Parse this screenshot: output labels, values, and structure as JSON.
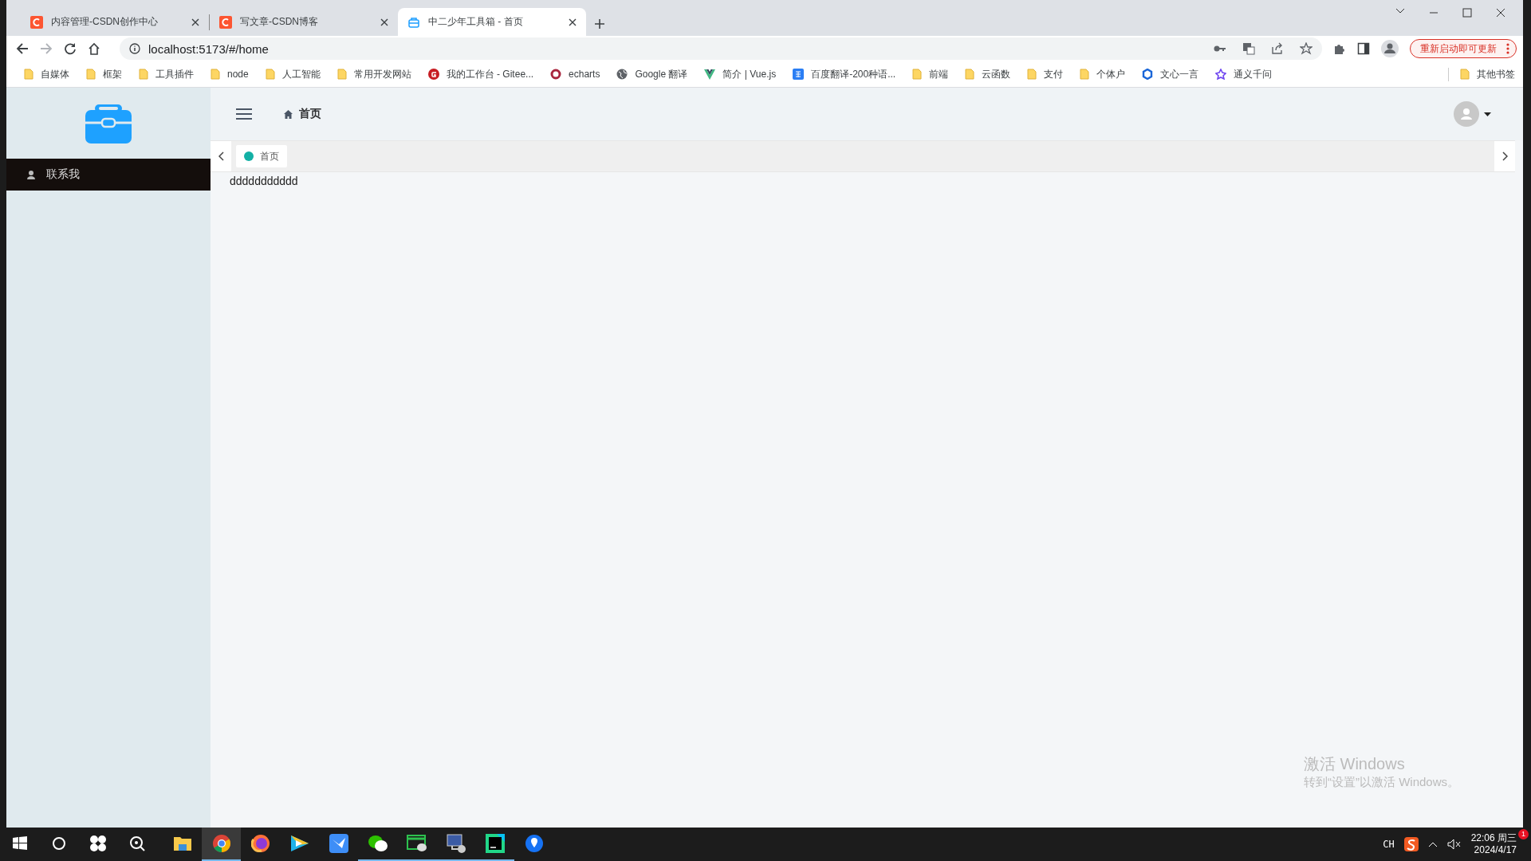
{
  "browser": {
    "tabs": [
      {
        "title": "内容管理-CSDN创作中心",
        "kind": "csdn",
        "selected": false
      },
      {
        "title": "写文章-CSDN博客",
        "kind": "csdn",
        "selected": false
      },
      {
        "title": "中二少年工具箱 - 首页",
        "kind": "toolbox",
        "selected": true
      }
    ],
    "nav": {
      "back_enabled": true,
      "forward_enabled": false
    },
    "address": "localhost:5173/#/home",
    "update_button": "重新启动即可更新",
    "bookmarks": [
      {
        "label": "自媒体",
        "kind": "folder"
      },
      {
        "label": "框架",
        "kind": "folder"
      },
      {
        "label": "工具插件",
        "kind": "folder"
      },
      {
        "label": "node",
        "kind": "folder"
      },
      {
        "label": "人工智能",
        "kind": "folder"
      },
      {
        "label": "常用开发网站",
        "kind": "folder"
      },
      {
        "label": "我的工作台 - Gitee...",
        "kind": "gitee"
      },
      {
        "label": "echarts",
        "kind": "ring"
      },
      {
        "label": "Google 翻译",
        "kind": "globe"
      },
      {
        "label": "简介 | Vue.js",
        "kind": "vue"
      },
      {
        "label": "百度翻译-200种语...",
        "kind": "square"
      },
      {
        "label": "前端",
        "kind": "folder"
      },
      {
        "label": "云函数",
        "kind": "folder"
      },
      {
        "label": "支付",
        "kind": "folder"
      },
      {
        "label": "个体户",
        "kind": "folder"
      },
      {
        "label": "文心一言",
        "kind": "hexagon"
      },
      {
        "label": "通义千问",
        "kind": "star"
      }
    ],
    "other_bookmarks": "其他书签"
  },
  "app": {
    "menu": [
      {
        "label": "联系我",
        "selected": true
      }
    ],
    "breadcrumb": "首页",
    "tags": [
      {
        "label": "首页",
        "selected": true
      }
    ],
    "content": "ddddddddddd"
  },
  "activation": {
    "title": "激活 Windows",
    "subtitle": "转到“设置”以激活 Windows。"
  },
  "taskbar": {
    "apps": [
      {
        "kind": "windows",
        "running": false,
        "selected": false
      },
      {
        "kind": "circle",
        "running": false,
        "selected": false
      },
      {
        "kind": "pinwheel",
        "running": false,
        "selected": false
      },
      {
        "kind": "search",
        "running": false,
        "selected": false
      },
      {
        "kind": "folder",
        "running": false,
        "selected": false
      },
      {
        "kind": "chrome",
        "running": true,
        "selected": true
      },
      {
        "kind": "firefox",
        "running": false,
        "selected": false
      },
      {
        "kind": "play",
        "running": false,
        "selected": false
      },
      {
        "kind": "bird",
        "running": false,
        "selected": false
      },
      {
        "kind": "wechat",
        "running": true,
        "selected": false
      },
      {
        "kind": "chat",
        "running": true,
        "selected": false
      },
      {
        "kind": "monitor",
        "running": true,
        "selected": false
      },
      {
        "kind": "ide",
        "running": true,
        "selected": false
      },
      {
        "kind": "pin",
        "running": false,
        "selected": false
      }
    ],
    "tray": {
      "language": "CH",
      "time": "22:06 周三",
      "date": "2024/4/17",
      "badge": "1"
    }
  }
}
